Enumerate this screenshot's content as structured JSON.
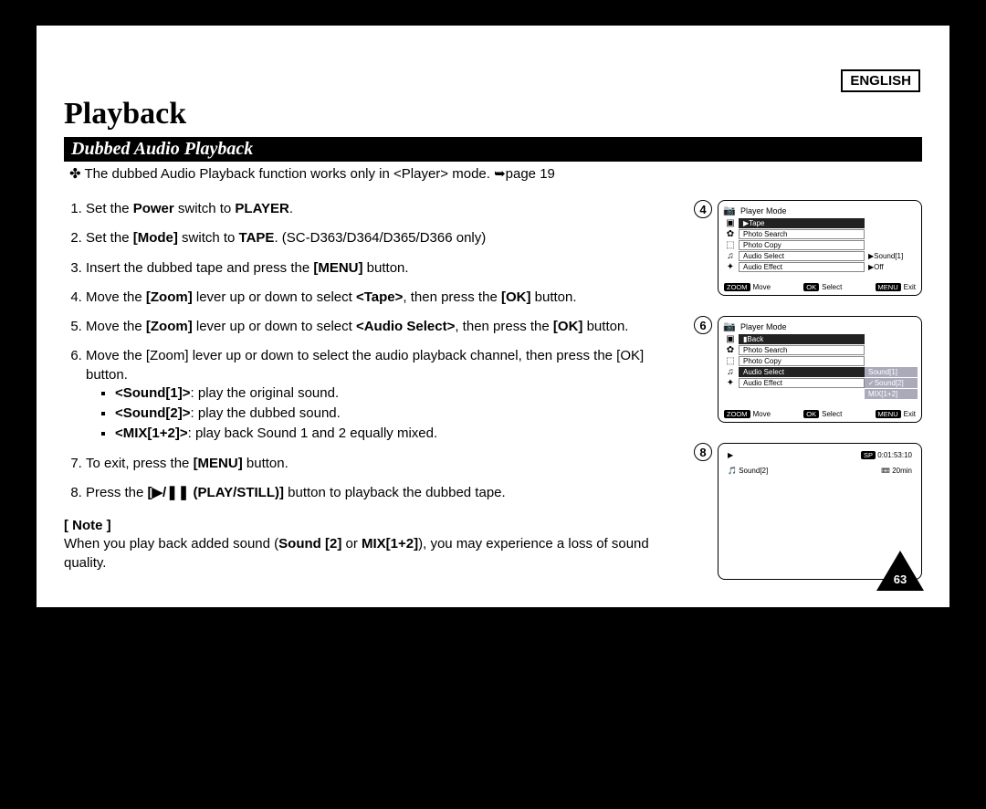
{
  "language": "ENGLISH",
  "title": "Playback",
  "section": "Dubbed Audio Playback",
  "intro": "The dubbed Audio Playback function works only in <Player> mode. ➥page 19",
  "steps": {
    "s1": "Set the Power switch to PLAYER.",
    "s2": "Set the Mode switch to TAPE. (SC-D363/D364/D365/D366 only)",
    "s3": "Insert the dubbed tape and press the [MENU] button.",
    "s4": "Move the [Zoom] lever up or down to select <Tape>, then press the [OK] button.",
    "s5": "Move the [Zoom] lever up or down to select <Audio Select>, then press the [OK] button.",
    "s6_a": "Move the [Zoom] lever up or down to select the audio playback channel, then press the [OK] button.",
    "s6_b1": "<Sound[1]>: play the original sound.",
    "s6_b2": "<Sound[2]>: play the dubbed sound.",
    "s6_b3": "<MIX[1+2]>: play back Sound 1 and 2 equally mixed.",
    "s7": "To exit, press the [MENU] button.",
    "s8": "Press the [▶/❚❚ (PLAY/STILL)] button to playback the dubbed tape."
  },
  "note_head": "[ Note ]",
  "note_body": "When you play back added sound (Sound [2] or MIX[1+2]), you may experience a loss of sound quality.",
  "fig4": {
    "num": "4",
    "header": "Player Mode",
    "rows": {
      "r1": "▶Tape",
      "r2": "Photo Search",
      "r3": "Photo Copy",
      "r4": "Audio Select",
      "r5": "Audio Effect",
      "opt4": "▶Sound[1]",
      "opt5": "▶Off"
    },
    "foot": {
      "zoom": "ZOOM",
      "move": "Move",
      "ok": "OK",
      "select": "Select",
      "menu": "MENU",
      "exit": "Exit"
    }
  },
  "fig6": {
    "num": "6",
    "header": "Player Mode",
    "rows": {
      "r1": "▮Back",
      "r2": "Photo Search",
      "r3": "Photo Copy",
      "r4": "Audio Select",
      "r5": "Audio Effect",
      "opt4a": "Sound[1]",
      "opt4b": "✓Sound[2]",
      "opt4c": "MIX[1+2]"
    },
    "foot": {
      "zoom": "ZOOM",
      "move": "Move",
      "ok": "OK",
      "select": "Select",
      "menu": "MENU",
      "exit": "Exit"
    }
  },
  "fig8": {
    "num": "8",
    "sp": "SP",
    "time": "0:01:53:10",
    "sound": "🎵 Sound[2]",
    "remain": "📼 20min",
    "play": "▶"
  },
  "page_number": "63"
}
